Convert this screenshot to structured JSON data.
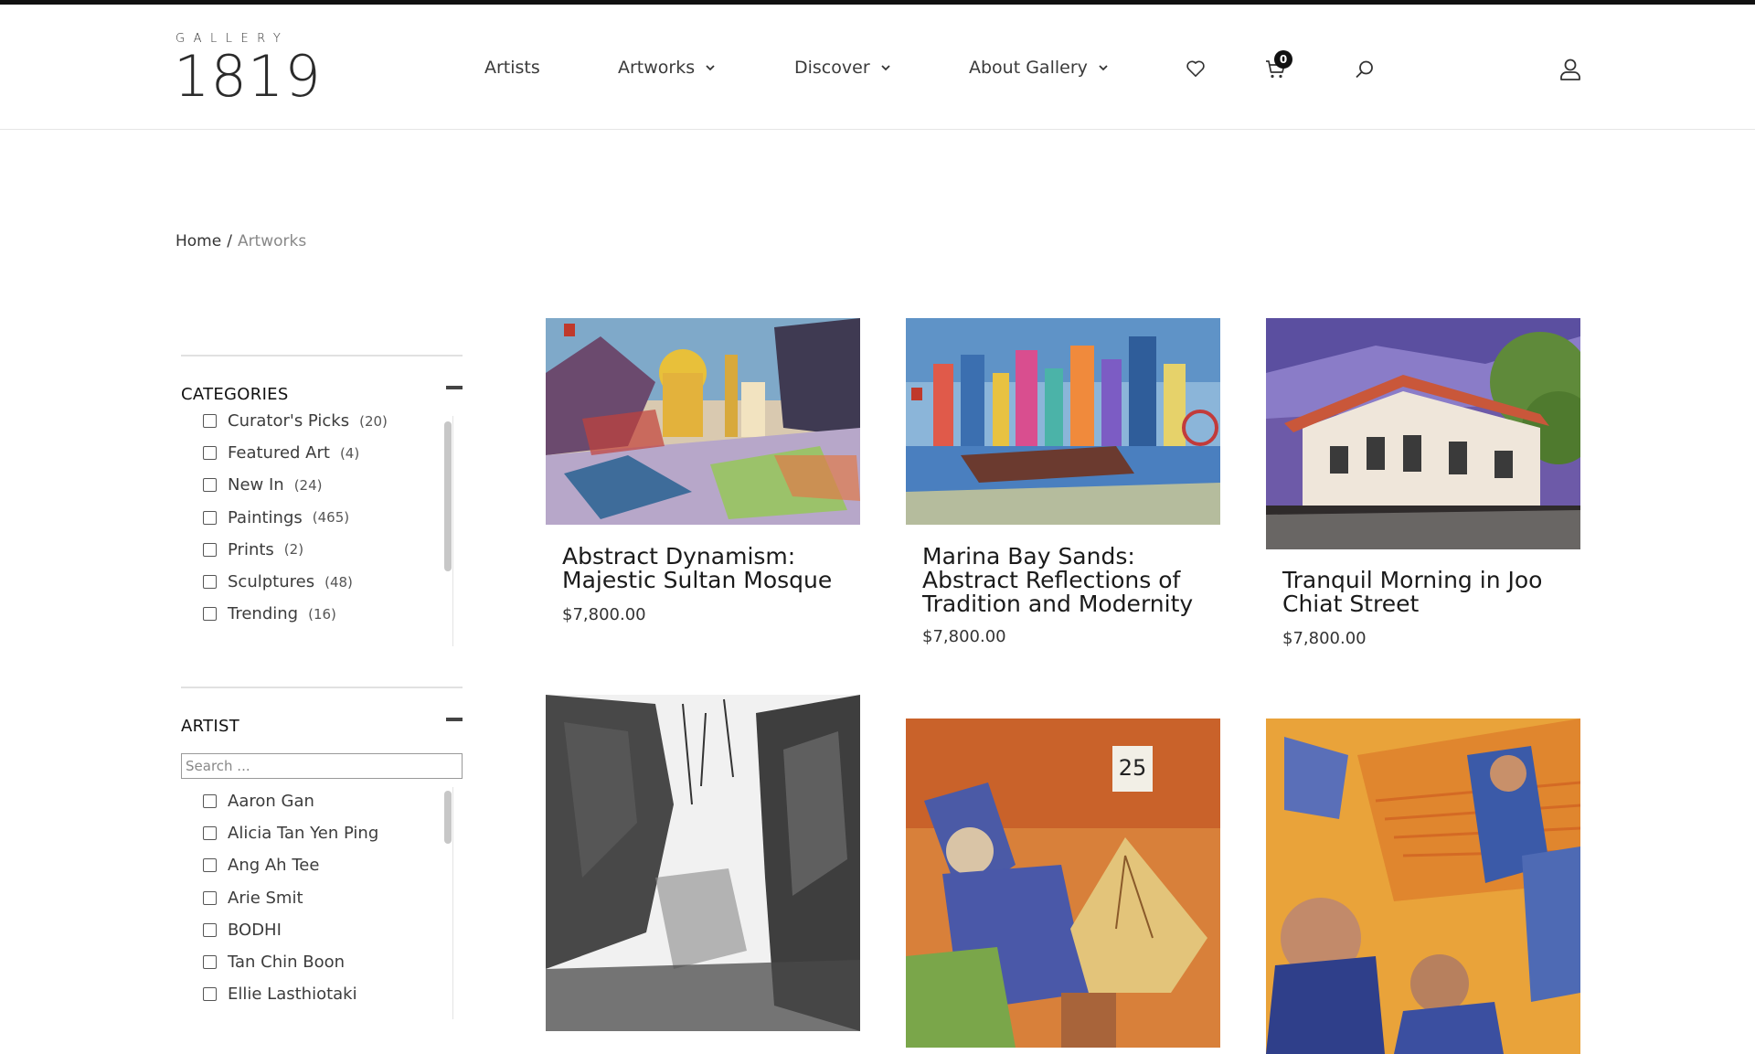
{
  "logo": {
    "small": "GALLERY",
    "big": "1819"
  },
  "nav": {
    "artists": "Artists",
    "artworks": "Artworks",
    "discover": "Discover",
    "about": "About Gallery"
  },
  "cart": {
    "count": "0"
  },
  "breadcrumb": {
    "home": "Home",
    "separator": "/",
    "current": "Artworks"
  },
  "categories": {
    "title": "CATEGORIES",
    "items": [
      {
        "label": "Curator's Picks",
        "count": "(20)"
      },
      {
        "label": "Featured Art",
        "count": "(4)"
      },
      {
        "label": "New In",
        "count": "(24)"
      },
      {
        "label": "Paintings",
        "count": "(465)"
      },
      {
        "label": "Prints",
        "count": "(2)"
      },
      {
        "label": "Sculptures",
        "count": "(48)"
      },
      {
        "label": "Trending",
        "count": "(16)"
      }
    ]
  },
  "artist": {
    "title": "ARTIST",
    "search_placeholder": "Search ...",
    "items": [
      {
        "label": "Aaron Gan"
      },
      {
        "label": "Alicia Tan Yen Ping"
      },
      {
        "label": "Ang Ah Tee"
      },
      {
        "label": "Arie Smit"
      },
      {
        "label": "BODHI"
      },
      {
        "label": "Tan Chin Boon"
      },
      {
        "label": "Ellie Lasthiotaki"
      }
    ]
  },
  "products": [
    {
      "name_line1": "Abstract Dynamism:",
      "name_line2": "Majestic Sultan Mosque",
      "name_line3": "",
      "price": "$7,800.00"
    },
    {
      "name_line1": "Marina Bay Sands:",
      "name_line2": "Abstract Reflections of",
      "name_line3": "Tradition and Modernity",
      "price": "$7,800.00"
    },
    {
      "name_line1": "Tranquil Morning in Joo",
      "name_line2": "Chiat Street",
      "name_line3": "",
      "price": "$7,800.00"
    },
    {
      "name_line1": "",
      "name_line2": "",
      "name_line3": "",
      "price": ""
    },
    {
      "name_line1": "",
      "name_line2": "",
      "name_line3": "",
      "price": "",
      "calendar_number": "25"
    },
    {
      "name_line1": "",
      "name_line2": "",
      "name_line3": "",
      "price": ""
    }
  ]
}
